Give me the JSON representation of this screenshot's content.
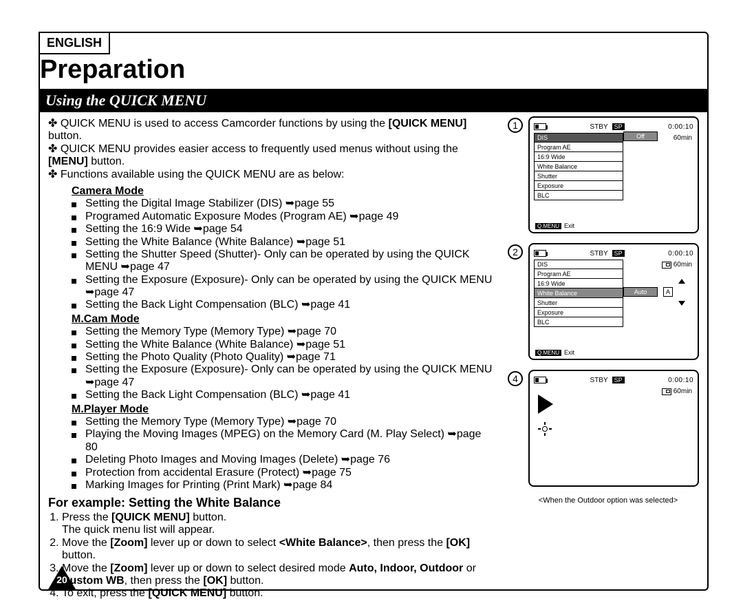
{
  "lang_badge": "ENGLISH",
  "title": "Preparation",
  "section_heading": "Using the QUICK MENU",
  "intro": [
    "QUICK MENU is used to access Camcorder functions by using the [QUICK MENU] button.",
    "QUICK MENU provides easier access to frequently used menus without using the [MENU] button.",
    "Functions available using the QUICK MENU are as below:"
  ],
  "intro_bold": {
    "0": "[QUICK MENU]",
    "1": "[MENU]"
  },
  "modes": {
    "camera": {
      "label": "Camera Mode",
      "items": [
        "Setting the Digital Image Stabilizer (DIS) ➥page 55",
        "Programed Automatic Exposure Modes (Program AE) ➥page 49",
        "Setting the 16:9 Wide ➥page 54",
        "Setting the White Balance (White Balance) ➥page 51",
        "Setting the Shutter Speed (Shutter)- Only can be operated by using the QUICK MENU ➥page 47",
        "Setting the Exposure (Exposure)- Only can be operated by using the QUICK MENU ➥page 47",
        "Setting the Back Light Compensation (BLC) ➥page 41"
      ]
    },
    "mcam": {
      "label": "M.Cam Mode",
      "items": [
        "Setting the Memory Type (Memory Type) ➥page 70",
        "Setting the White Balance (White Balance) ➥page 51",
        "Setting the Photo Quality (Photo Quality) ➥page 71",
        "Setting the Exposure (Exposure)- Only can be operated by using the QUICK MENU ➥page 47",
        "Setting the Back Light Compensation (BLC) ➥page 41"
      ]
    },
    "mplayer": {
      "label": "M.Player Mode",
      "items": [
        "Setting the Memory Type (Memory Type) ➥page 70",
        "Playing the Moving Images (MPEG) on the Memory Card (M. Play Select) ➥page 80",
        "Deleting Photo Images and Moving Images (Delete) ➥page 76",
        "Protection from accidental Erasure (Protect) ➥page 75",
        "Marking Images for Printing (Print Mark) ➥page 84"
      ]
    }
  },
  "example": {
    "heading": "For example: Setting the White Balance",
    "steps": [
      {
        "pre": "Press the ",
        "b1": "[QUICK MENU]",
        "mid": " button.",
        "tail": "The quick menu list will appear."
      },
      {
        "pre": "Move the ",
        "b1": "[Zoom]",
        "mid": " lever up or down to select ",
        "b2": "<White Balance>",
        "mid2": ", then press the ",
        "b3": "[OK]",
        "post": " button."
      },
      {
        "pre": "Move the ",
        "b1": "[Zoom]",
        "mid": " lever up or down to select desired mode ",
        "b2": "Auto, Indoor, Outdoor",
        "mid2": " or ",
        "b3": "Custom WB",
        "mid3": ", then press the ",
        "b4": "[OK]",
        "post": " button."
      },
      {
        "pre": "To exit, press the ",
        "b1": "[QUICK MENU]",
        "post": " button."
      }
    ]
  },
  "page_number": "20",
  "screens": {
    "shared": {
      "stby": "STBY",
      "sp": "SP",
      "time": "0:00:10",
      "remaining": "60min",
      "qmenu": "Q.MENU",
      "exit": "Exit"
    },
    "s1": {
      "num": "1",
      "menu": [
        "DIS",
        "Program AE",
        "16:9 Wide",
        "White Balance",
        "Shutter",
        "Exposure",
        "BLC"
      ],
      "dis_val": "Off"
    },
    "s2": {
      "num": "2",
      "menu": [
        "DIS",
        "Program AE",
        "16:9 Wide",
        "White Balance",
        "Shutter",
        "Exposure",
        "BLC"
      ],
      "sel_val": "Auto",
      "sel_a": "A"
    },
    "s4": {
      "num": "4"
    },
    "caption": "<When the Outdoor option was selected>"
  }
}
